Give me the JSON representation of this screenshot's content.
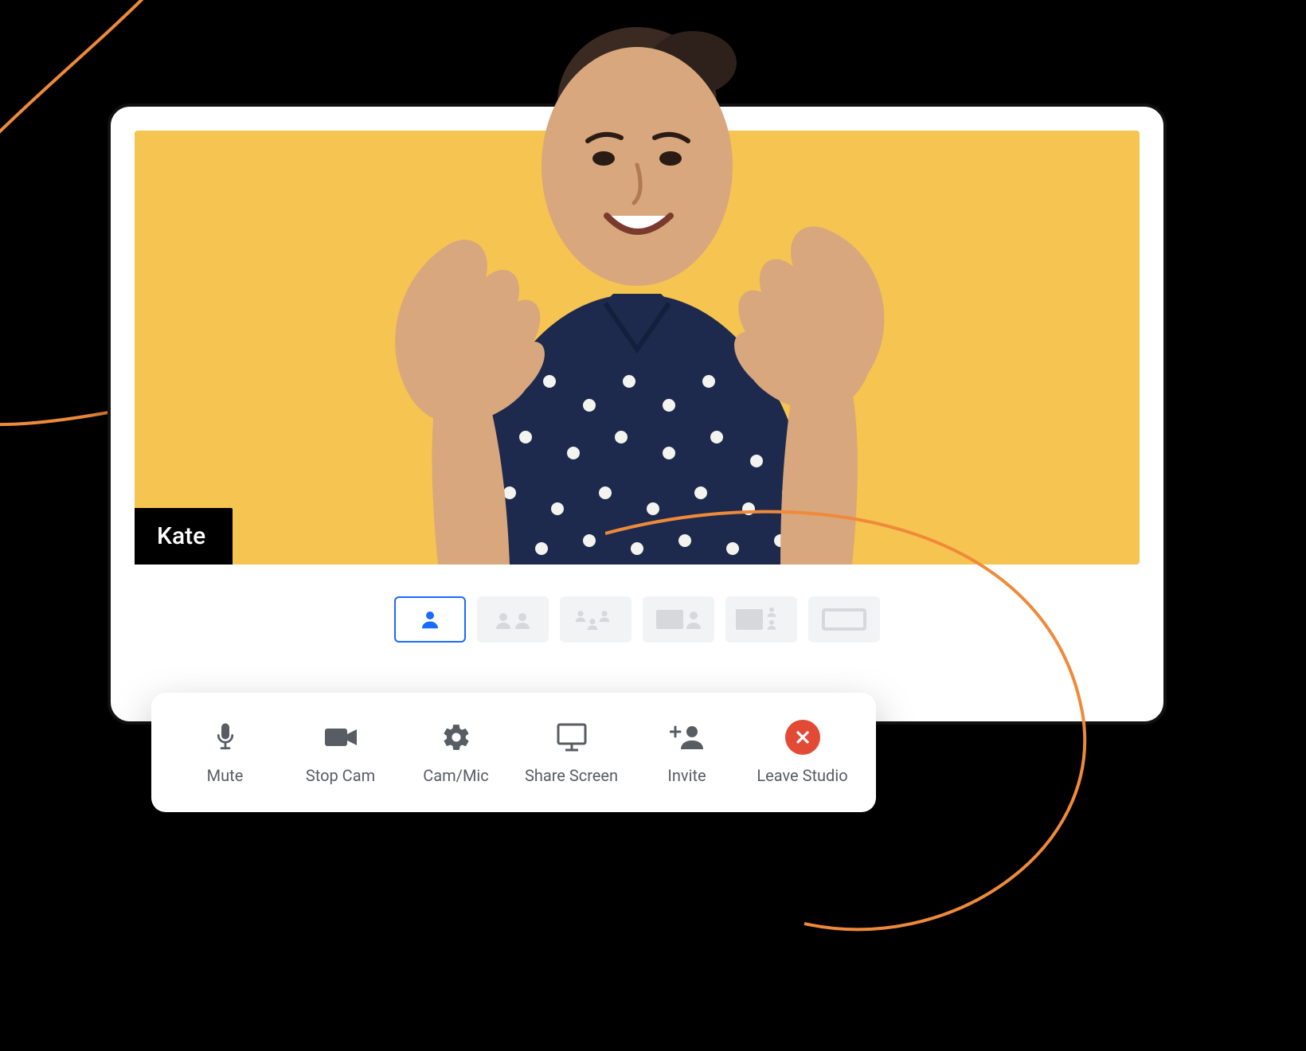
{
  "colors": {
    "stage_bg": "#f5c451",
    "accent_blue": "#1a6aff",
    "leave_red": "#e34a36",
    "icon_gray": "#585c63",
    "swoosh_orange": "#ef8a3a"
  },
  "participant": {
    "name": "Kate"
  },
  "layouts": {
    "active_index": 0,
    "options": [
      {
        "id": "solo",
        "icon": "person-solo-icon"
      },
      {
        "id": "two-up",
        "icon": "layout-two-icon"
      },
      {
        "id": "three-up",
        "icon": "layout-three-icon"
      },
      {
        "id": "screen-one",
        "icon": "layout-screen-one-icon"
      },
      {
        "id": "screen-two",
        "icon": "layout-screen-two-icon"
      },
      {
        "id": "full",
        "icon": "layout-full-icon"
      }
    ]
  },
  "toolbar": {
    "mute": {
      "label": "Mute",
      "icon": "mic-icon"
    },
    "stop_cam": {
      "label": "Stop Cam",
      "icon": "camera-icon"
    },
    "cam_mic": {
      "label": "Cam/Mic",
      "icon": "gear-icon"
    },
    "share_screen": {
      "label": "Share Screen",
      "icon": "screen-share-icon"
    },
    "invite": {
      "label": "Invite",
      "icon": "add-user-icon"
    },
    "leave": {
      "label": "Leave Studio",
      "icon": "close-icon"
    }
  }
}
